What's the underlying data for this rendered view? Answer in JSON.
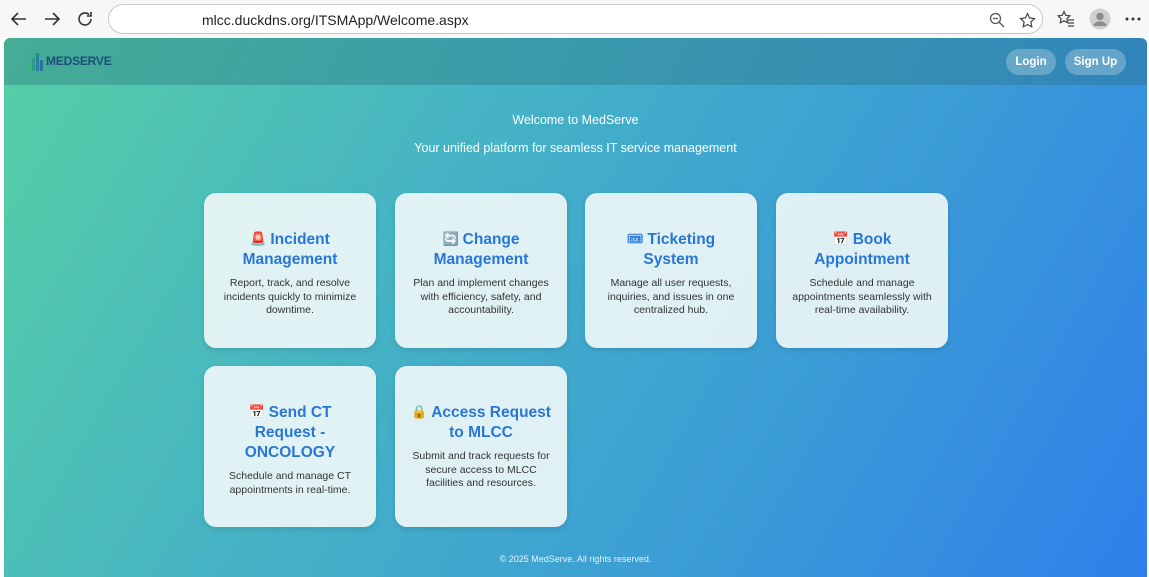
{
  "browser": {
    "url": "mlcc.duckdns.org/ITSMApp/Welcome.aspx",
    "icons": [
      "back-arrow-icon",
      "forward-arrow-icon",
      "refresh-icon",
      "zoom-icon",
      "star-icon",
      "favorites-icon",
      "profile-icon",
      "more-icon"
    ]
  },
  "header": {
    "logo_text": "MEDSERVE",
    "login_label": "Login",
    "signup_label": "Sign Up"
  },
  "hero": {
    "title": "Welcome to MedServe",
    "subtitle": "Your unified platform for seamless IT service management"
  },
  "cards": [
    {
      "icon": "🚨",
      "icon_name": "siren-icon",
      "title": "Incident Management",
      "desc": "Report, track, and resolve incidents quickly to minimize downtime."
    },
    {
      "icon": "🔄",
      "icon_name": "refresh-arrows-icon",
      "title": "Change Management",
      "desc": "Plan and implement changes with efficiency, safety, and accountability."
    },
    {
      "icon": "🎟",
      "icon_name": "ticket-icon",
      "title": "Ticketing System",
      "desc": "Manage all user requests, inquiries, and issues in one centralized hub."
    },
    {
      "icon": "📅",
      "icon_name": "calendar-icon",
      "title": "Book Appointment",
      "desc": "Schedule and manage appointments seamlessly with real-time availability."
    },
    {
      "icon": "📅",
      "icon_name": "calendar-icon",
      "title": "Send CT Request - ONCOLOGY",
      "desc": "Schedule and manage CT appointments in real-time."
    },
    {
      "icon": "🔒",
      "icon_name": "lock-icon",
      "title": "Access Request to MLCC",
      "desc": "Submit and track requests for secure access to MLCC facilities and resources."
    }
  ],
  "footer": {
    "text": "© 2025 MedServe. All rights reserved."
  }
}
